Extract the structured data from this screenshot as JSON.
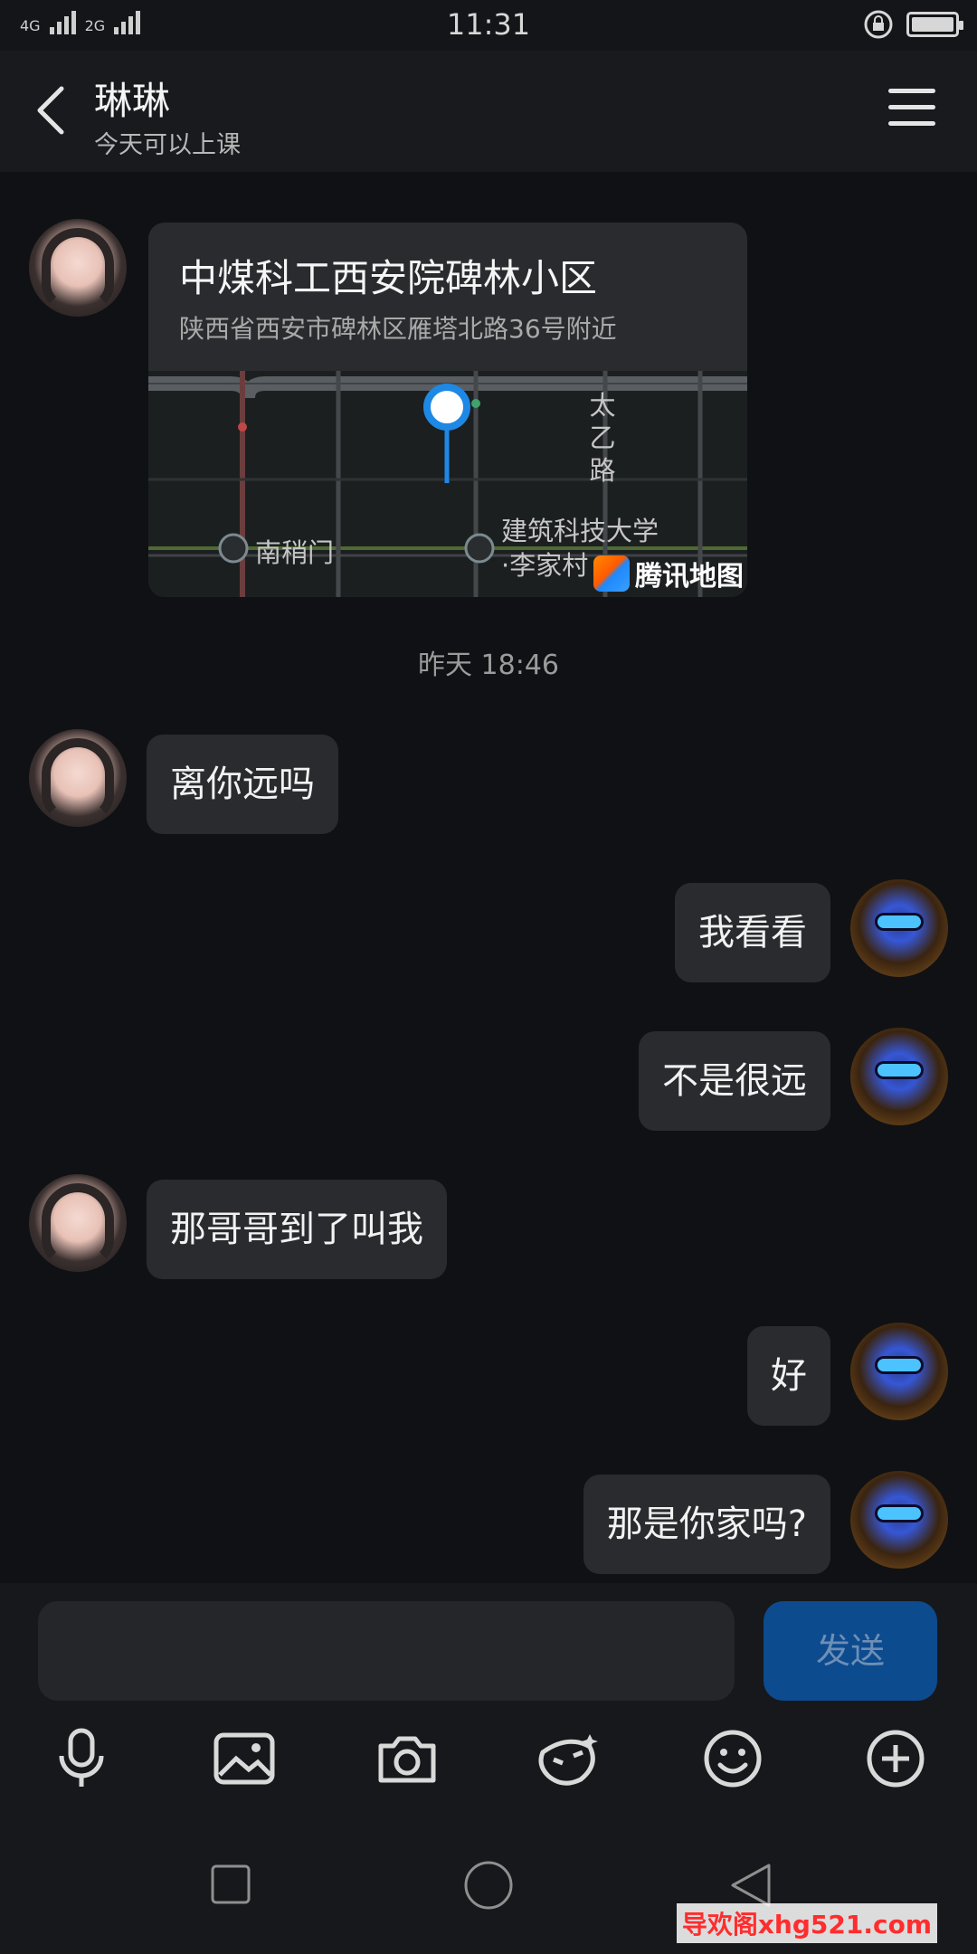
{
  "status_bar": {
    "network_labels": [
      "4G",
      "2G"
    ],
    "time": "11:31"
  },
  "header": {
    "title": "琳琳",
    "subtitle": "今天可以上课"
  },
  "location_card": {
    "title": "中煤科工西安院碑林小区",
    "address": "陕西省西安市碑林区雁塔北路36号附近",
    "map_labels": {
      "road": "太乙路",
      "station_1": "南稍门",
      "station_2_line1": "建筑科技大学",
      "station_2_line2": "·李家村",
      "provider": "腾讯地图"
    }
  },
  "timestamp": "昨天 18:46",
  "messages": [
    {
      "side": "left",
      "text": "离你远吗"
    },
    {
      "side": "right",
      "text": "我看看"
    },
    {
      "side": "right",
      "text": "不是很远"
    },
    {
      "side": "left",
      "text": "那哥哥到了叫我"
    },
    {
      "side": "right",
      "text": "好"
    },
    {
      "side": "right",
      "text": "那是你家吗?"
    }
  ],
  "input": {
    "value": "",
    "send_label": "发送"
  },
  "toolbar_icons": [
    "mic-icon",
    "image-icon",
    "camera-icon",
    "sticker-icon",
    "emoji-icon",
    "plus-icon"
  ],
  "watermark": "导欢阁xhg521.com",
  "colors": {
    "background": "#101114",
    "bubble": "#2a2b2f",
    "send_button": "#0d4b8f",
    "map_pin": "#1e88e5"
  }
}
